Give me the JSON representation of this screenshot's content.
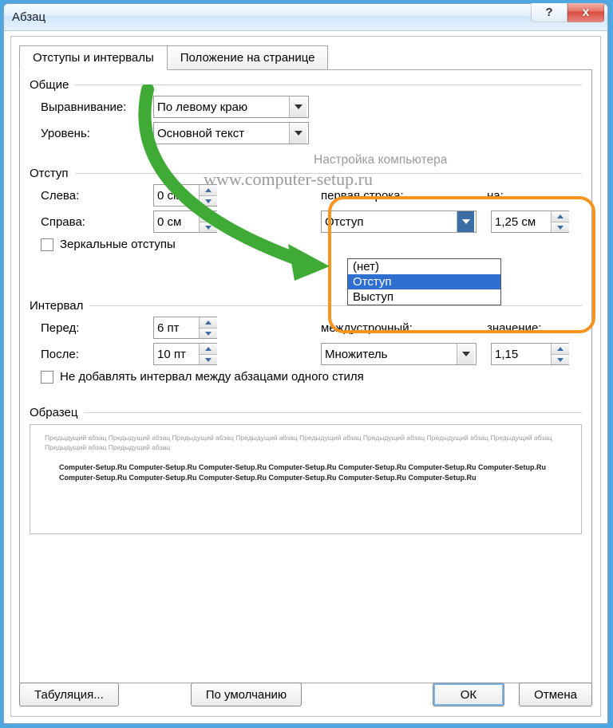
{
  "window_title": "Абзац",
  "titlebar_help": "?",
  "titlebar_close": "x",
  "tabs": {
    "indents": "Отступы и интервалы",
    "position": "Положение на странице"
  },
  "sections": {
    "general": "Общие",
    "indent": "Отступ",
    "spacing": "Интервал",
    "preview": "Образец"
  },
  "labels": {
    "alignment": "Выравнивание:",
    "outline": "Уровень:",
    "left": "Слева:",
    "right": "Справа:",
    "mirror": "Зеркальные отступы",
    "first_line": "первая строка:",
    "by": "на:",
    "before": "Перед:",
    "after": "После:",
    "line_spacing": "междустрочный:",
    "value": "значение:",
    "no_space": "Не добавлять интервал между абзацами одного стиля"
  },
  "values": {
    "alignment": "По левому краю",
    "outline": "Основной текст",
    "left": "0 см",
    "right": "0 см",
    "first_line_sel": "Отступ",
    "by": "1,25 см",
    "before": "6 пт",
    "after": "10 пт",
    "line_spacing": "Множитель",
    "value": "1,15"
  },
  "firstline_options": [
    "(нет)",
    "Отступ",
    "Выступ"
  ],
  "watermark": {
    "line1": "Настройка компьютера",
    "line2": "www.computer-setup.ru"
  },
  "preview": {
    "grey": "Предыдущий абзац Предыдущий абзац Предыдущий абзац Предыдущий абзац Предыдущий абзац Предыдущий абзац Предыдущий абзац Предыдущий абзац Предыдущий абзац Предыдущий абзац",
    "dark": "Computer-Setup.Ru Computer-Setup.Ru Computer-Setup.Ru Computer-Setup.Ru Computer-Setup.Ru Computer-Setup.Ru Computer-Setup.Ru Computer-Setup.Ru Computer-Setup.Ru Computer-Setup.Ru Computer-Setup.Ru Computer-Setup.Ru Computer-Setup.Ru"
  },
  "buttons": {
    "tabs": "Табуляция...",
    "default": "По умолчанию",
    "ok": "ОК",
    "cancel": "Отмена"
  }
}
